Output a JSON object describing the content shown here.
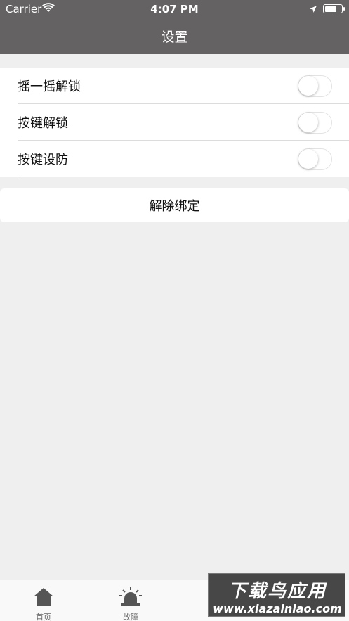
{
  "status_bar": {
    "carrier": "Carrier",
    "time": "4:07 PM",
    "battery_level": 0.75
  },
  "nav": {
    "title": "设置"
  },
  "settings": {
    "rows": [
      {
        "label": "摇一摇解锁",
        "enabled": false
      },
      {
        "label": "按键解锁",
        "enabled": false
      },
      {
        "label": "按键设防",
        "enabled": false
      }
    ],
    "unbind_label": "解除绑定"
  },
  "tabbar": {
    "items": [
      {
        "label": "首页",
        "icon": "home-icon"
      },
      {
        "label": "故障",
        "icon": "alarm-icon"
      }
    ]
  },
  "watermark": {
    "logo_text": "下载鸟应用",
    "url_text": "www.xiazainiao.com"
  },
  "colors": {
    "header_bg": "#646262",
    "page_bg": "#efefef"
  }
}
